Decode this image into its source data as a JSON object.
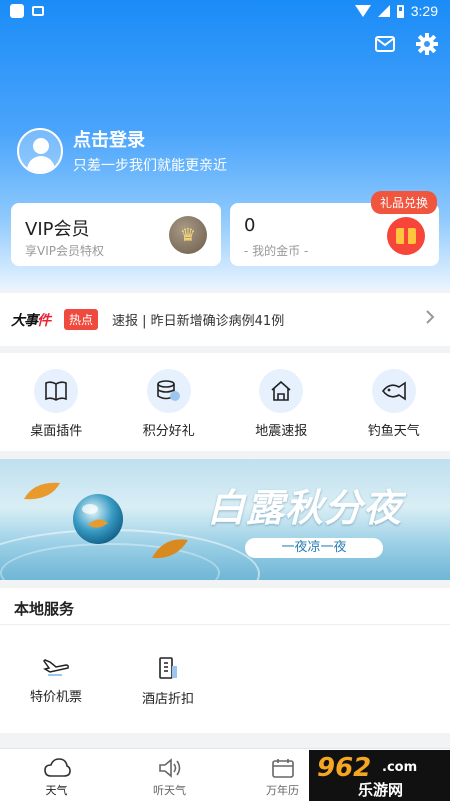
{
  "status_bar": {
    "time": "3:29"
  },
  "header": {
    "mail_icon": "mail-icon",
    "settings_icon": "gear-icon"
  },
  "login": {
    "title": "点击登录",
    "subtitle": "只差一步我们就能更亲近"
  },
  "vip_card": {
    "title": "VIP会员",
    "subtitle": "享VIP会员特权",
    "icon": "crown-icon"
  },
  "coin_card": {
    "value": "0",
    "subtitle": "- 我的金币 -",
    "badge": "礼品兑换",
    "icon": "gift-icon"
  },
  "news": {
    "logo_main": "大事",
    "logo_accent": "件",
    "tag": "热点",
    "text": "速报 | 昨日新增确诊病例41例"
  },
  "quick_actions": [
    {
      "label": "桌面插件",
      "icon": "book-icon"
    },
    {
      "label": "积分好礼",
      "icon": "coins-icon"
    },
    {
      "label": "地震速报",
      "icon": "house-icon"
    },
    {
      "label": "钓鱼天气",
      "icon": "fish-icon"
    }
  ],
  "banner": {
    "title": "白露秋分夜",
    "subtitle": "一夜凉一夜"
  },
  "local_services": {
    "title": "本地服务",
    "items": [
      {
        "label": "特价机票",
        "icon": "plane-icon"
      },
      {
        "label": "酒店折扣",
        "icon": "hotel-icon"
      }
    ]
  },
  "tabs": [
    {
      "label": "天气",
      "icon": "cloud-icon"
    },
    {
      "label": "听天气",
      "icon": "speaker-icon"
    },
    {
      "label": "万年历",
      "icon": "calendar-icon"
    }
  ],
  "watermark": {
    "number": "962",
    "domain": ".com",
    "name": "乐游网"
  },
  "colors": {
    "primary_blue": "#1a8cf7",
    "hot_red": "#f04a3e",
    "gift_orange": "#ffc53d"
  }
}
